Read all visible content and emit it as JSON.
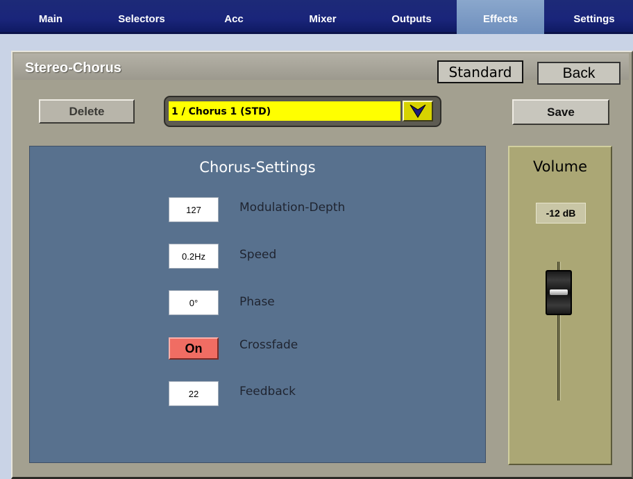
{
  "nav": {
    "tabs": [
      {
        "label": "Main"
      },
      {
        "label": "Selectors"
      },
      {
        "label": "Acc"
      },
      {
        "label": "Mixer"
      },
      {
        "label": "Outputs"
      },
      {
        "label": "Effects",
        "active": true
      },
      {
        "label": "Settings"
      }
    ]
  },
  "header": {
    "title": "Stereo-Chorus",
    "standard_label": "Standard",
    "back_label": "Back"
  },
  "toolbar": {
    "delete_label": "Delete",
    "save_label": "Save",
    "preset_value": "1 / Chorus 1 (STD)",
    "preset_arrow_icon": "chevron-down-icon",
    "preset_color": "#ffff00"
  },
  "settings": {
    "title": "Chorus-Settings",
    "params": [
      {
        "value": "127",
        "label": "Modulation-Depth"
      },
      {
        "value": "0.2Hz",
        "label": "Speed"
      },
      {
        "value": "0°",
        "label": "Phase"
      },
      {
        "value": "On",
        "label": "Crossfade"
      },
      {
        "value": "22",
        "label": "Feedback"
      }
    ]
  },
  "volume": {
    "title": "Volume",
    "value": "-12 dB"
  },
  "colors": {
    "nav_bg": "#1a257a",
    "active_tab": "#7a97c4",
    "settings_bg": "#58718e",
    "volume_bg": "#aba775",
    "crossfade_on": "#f06d63"
  }
}
